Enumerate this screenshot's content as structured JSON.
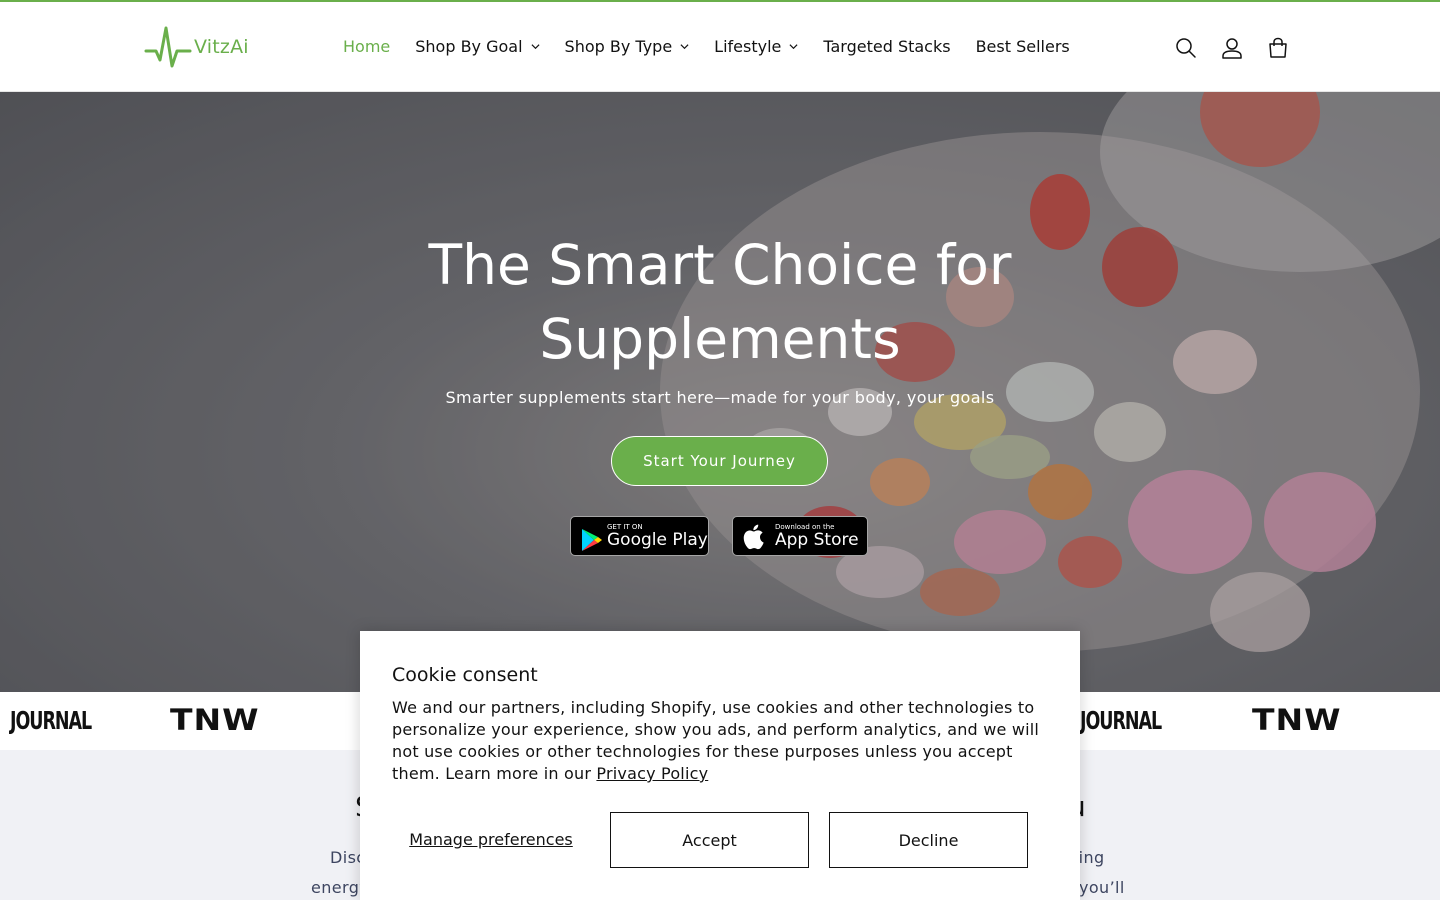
{
  "brand": {
    "name": "VitzAi",
    "accent_color": "#6aaf4b"
  },
  "nav": {
    "items": [
      {
        "label": "Home",
        "active": true,
        "dropdown": false
      },
      {
        "label": "Shop By Goal",
        "active": false,
        "dropdown": true
      },
      {
        "label": "Shop By Type",
        "active": false,
        "dropdown": true
      },
      {
        "label": "Lifestyle",
        "active": false,
        "dropdown": true
      },
      {
        "label": "Targeted Stacks",
        "active": false,
        "dropdown": false
      },
      {
        "label": "Best Sellers",
        "active": false,
        "dropdown": false
      }
    ],
    "icons": [
      "search-icon",
      "account-icon",
      "cart-icon"
    ]
  },
  "hero": {
    "title_line1": "The Smart Choice for",
    "title_line2": "Supplements",
    "subtitle": "Smarter supplements start here—made for your body, your goals",
    "cta_label": "Start Your Journey",
    "google_play": {
      "small": "GET IT ON",
      "big": "Google Play"
    },
    "app_store": {
      "small": "Download on the",
      "big": "App Store"
    }
  },
  "press": {
    "logos": [
      "JOURNAL",
      "TNW",
      "JOURNAL",
      "TNW"
    ]
  },
  "section": {
    "title_left": "S",
    "title_right": "u",
    "line1_left": "Disc",
    "line1_right": "ting",
    "line2_left": "energy",
    "line2_right": ", you’ll"
  },
  "cookie": {
    "title": "Cookie consent",
    "body": "We and our partners, including Shopify, use cookies and other technologies to personalize your experience, show you ads, and perform analytics, and we will not use cookies or other technologies for these purposes unless you accept them. Learn more in our ",
    "link_label": "Privacy Policy",
    "manage_label": "Manage preferences",
    "accept_label": "Accept",
    "decline_label": "Decline"
  }
}
